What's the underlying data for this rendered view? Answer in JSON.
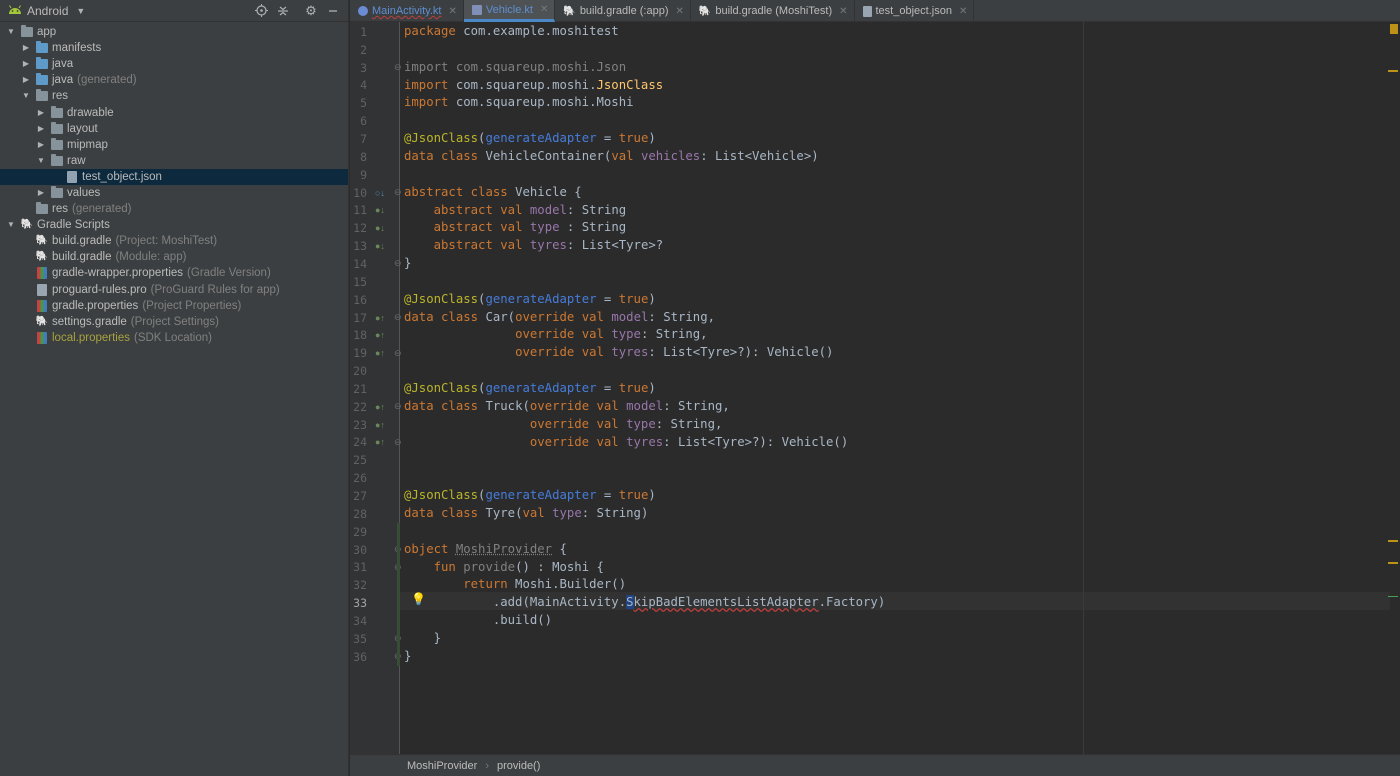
{
  "project_panel": {
    "title": "Android",
    "tree": [
      {
        "label": "app",
        "hint": "",
        "depth": 0,
        "expanded": true,
        "icon": "module-folder"
      },
      {
        "label": "manifests",
        "hint": "",
        "depth": 1,
        "expanded": false,
        "icon": "folder"
      },
      {
        "label": "java",
        "hint": "",
        "depth": 1,
        "expanded": false,
        "icon": "folder"
      },
      {
        "label": "java",
        "hint": "(generated)",
        "depth": 1,
        "expanded": false,
        "icon": "folder"
      },
      {
        "label": "res",
        "hint": "",
        "depth": 1,
        "expanded": true,
        "icon": "folder"
      },
      {
        "label": "drawable",
        "hint": "",
        "depth": 2,
        "expanded": false,
        "icon": "folder"
      },
      {
        "label": "layout",
        "hint": "",
        "depth": 2,
        "expanded": false,
        "icon": "folder"
      },
      {
        "label": "mipmap",
        "hint": "",
        "depth": 2,
        "expanded": false,
        "icon": "folder"
      },
      {
        "label": "raw",
        "hint": "",
        "depth": 2,
        "expanded": true,
        "icon": "folder"
      },
      {
        "label": "test_object.json",
        "hint": "",
        "depth": 3,
        "expanded": null,
        "icon": "file"
      },
      {
        "label": "values",
        "hint": "",
        "depth": 2,
        "expanded": false,
        "icon": "folder"
      },
      {
        "label": "res",
        "hint": "(generated)",
        "depth": 1,
        "expanded": null,
        "icon": "folder"
      },
      {
        "label": "Gradle Scripts",
        "hint": "",
        "depth": 0,
        "expanded": true,
        "icon": "gradle"
      },
      {
        "label": "build.gradle",
        "hint": "(Project: MoshiTest)",
        "depth": 1,
        "expanded": null,
        "icon": "gradle"
      },
      {
        "label": "build.gradle",
        "hint": "(Module: app)",
        "depth": 1,
        "expanded": null,
        "icon": "gradle"
      },
      {
        "label": "gradle-wrapper.properties",
        "hint": "(Gradle Version)",
        "depth": 1,
        "expanded": null,
        "icon": "properties"
      },
      {
        "label": "proguard-rules.pro",
        "hint": "(ProGuard Rules for app)",
        "depth": 1,
        "expanded": null,
        "icon": "file"
      },
      {
        "label": "gradle.properties",
        "hint": "(Project Properties)",
        "depth": 1,
        "expanded": null,
        "icon": "properties"
      },
      {
        "label": "settings.gradle",
        "hint": "(Project Settings)",
        "depth": 1,
        "expanded": null,
        "icon": "gradle"
      },
      {
        "label": "local.properties",
        "hint": "(SDK Location)",
        "depth": 1,
        "expanded": null,
        "icon": "properties"
      }
    ],
    "selected_index": 9
  },
  "tabs": [
    {
      "label": "MainActivity.kt",
      "active": false,
      "error": true,
      "icon": "kotlin-class-icon"
    },
    {
      "label": "Vehicle.kt",
      "active": true,
      "error": false,
      "icon": "kotlin-file-icon"
    },
    {
      "label": "build.gradle (:app)",
      "active": false,
      "error": false,
      "icon": "gradle-icon"
    },
    {
      "label": "build.gradle (MoshiTest)",
      "active": false,
      "error": false,
      "icon": "gradle-icon"
    },
    {
      "label": "test_object.json",
      "active": false,
      "error": false,
      "icon": "json-file-icon"
    }
  ],
  "editor": {
    "current_line": 33,
    "lines": [
      "package com.example.moshitest",
      "",
      "import com.squareup.moshi.Json",
      "import com.squareup.moshi.JsonClass",
      "import com.squareup.moshi.Moshi",
      "",
      "@JsonClass(generateAdapter = true)",
      "data class VehicleContainer(val vehicles: List<Vehicle>)",
      "",
      "abstract class Vehicle {",
      "    abstract val model: String",
      "    abstract val type : String",
      "    abstract val tyres: List<Tyre>?",
      "}",
      "",
      "@JsonClass(generateAdapter = true)",
      "data class Car(override val model: String,",
      "               override val type: String,",
      "               override val tyres: List<Tyre>?): Vehicle()",
      "",
      "@JsonClass(generateAdapter = true)",
      "data class Truck(override val model: String,",
      "                 override val type: String,",
      "                 override val tyres: List<Tyre>?): Vehicle()",
      "",
      "",
      "@JsonClass(generateAdapter = true)",
      "data class Tyre(val type: String)",
      "",
      "object MoshiProvider {",
      "    fun provide() : Moshi {",
      "        return Moshi.Builder()",
      "            .add(MainActivity.SkipBadElementsListAdapter.Factory)",
      "            .build()",
      "    }",
      "}"
    ]
  },
  "breadcrumb": [
    "MoshiProvider",
    "provide()"
  ],
  "colors": {
    "keyword": "#cc7832",
    "annotation": "#bbb529",
    "named_param": "#467cda",
    "property": "#9876aa",
    "function": "#ffc66d",
    "default_text": "#a9b7c6",
    "panel_bg": "#3c3f41",
    "editor_bg": "#2b2b2b",
    "selection": "#0d293e",
    "active_tab_underline": "#4a88c7"
  }
}
